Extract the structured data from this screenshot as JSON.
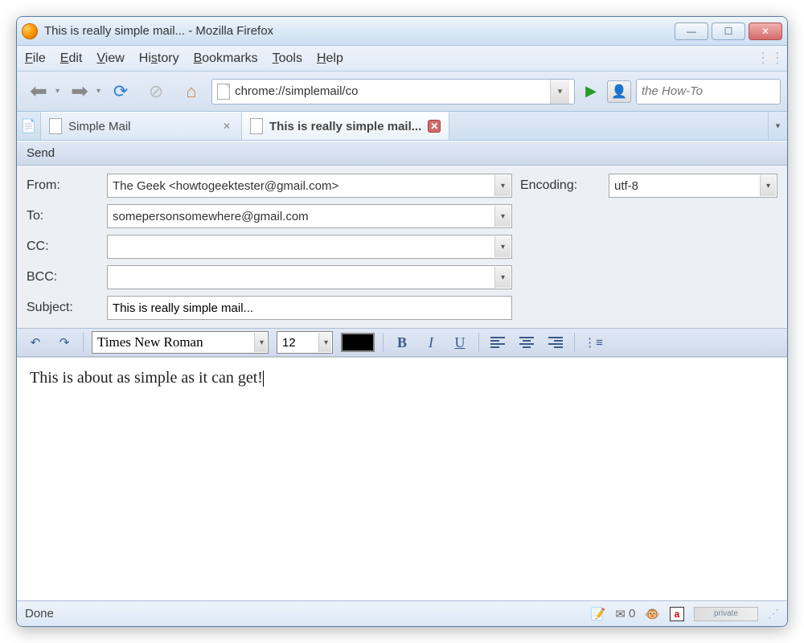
{
  "window": {
    "title": "This is really simple mail... - Mozilla Firefox"
  },
  "menubar": {
    "items": [
      "File",
      "Edit",
      "View",
      "History",
      "Bookmarks",
      "Tools",
      "Help"
    ]
  },
  "navbar": {
    "url": "chrome://simplemail/co",
    "search_placeholder": "the How-To"
  },
  "tabs": [
    {
      "label": "Simple Mail",
      "active": false
    },
    {
      "label": "This is really simple mail...",
      "active": true
    }
  ],
  "compose": {
    "toolbar_send": "Send",
    "from_label": "From:",
    "from_value": "The Geek <howtogeektester@gmail.com>",
    "to_label": "To:",
    "to_value": "somepersonsomewhere@gmail.com",
    "cc_label": "CC:",
    "cc_value": "",
    "bcc_label": "BCC:",
    "bcc_value": "",
    "subject_label": "Subject:",
    "subject_value": "This is really simple mail...",
    "encoding_label": "Encoding:",
    "encoding_value": "utf-8"
  },
  "format": {
    "font": "Times New Roman",
    "size": "12",
    "color": "#000000"
  },
  "body_text": "This is about as simple as it can get!",
  "statusbar": {
    "text": "Done",
    "mail_count": "0",
    "private_label": "private"
  }
}
